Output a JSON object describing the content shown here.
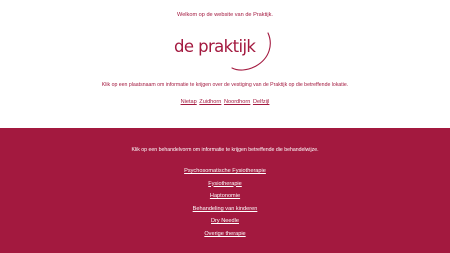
{
  "welcome_text": "Welkom op de website van de Praktijk.",
  "logo": {
    "text": "de praktijk",
    "color": "#a3193f"
  },
  "locations": {
    "intro": "Klik op een plaatsnaam om informatie te krijgen over de vestiging van de Praktijk op die betreffende lokatie.",
    "items": [
      "Nietap",
      "Zuidhorn",
      "Noordhorn",
      "Delfzijl"
    ]
  },
  "treatments": {
    "intro": "Klik op een behandelvorm om informatie te krijgen betreffende die behandelwijze.",
    "items": [
      "Psychosomatische Fysiotherapie",
      "Fysiotherapie",
      "Haptonomie",
      "Behandeling van kinderen",
      "Dry Needle",
      "Overige therapie"
    ]
  },
  "colors": {
    "brand": "#a3193f",
    "background": "#ffffff"
  }
}
